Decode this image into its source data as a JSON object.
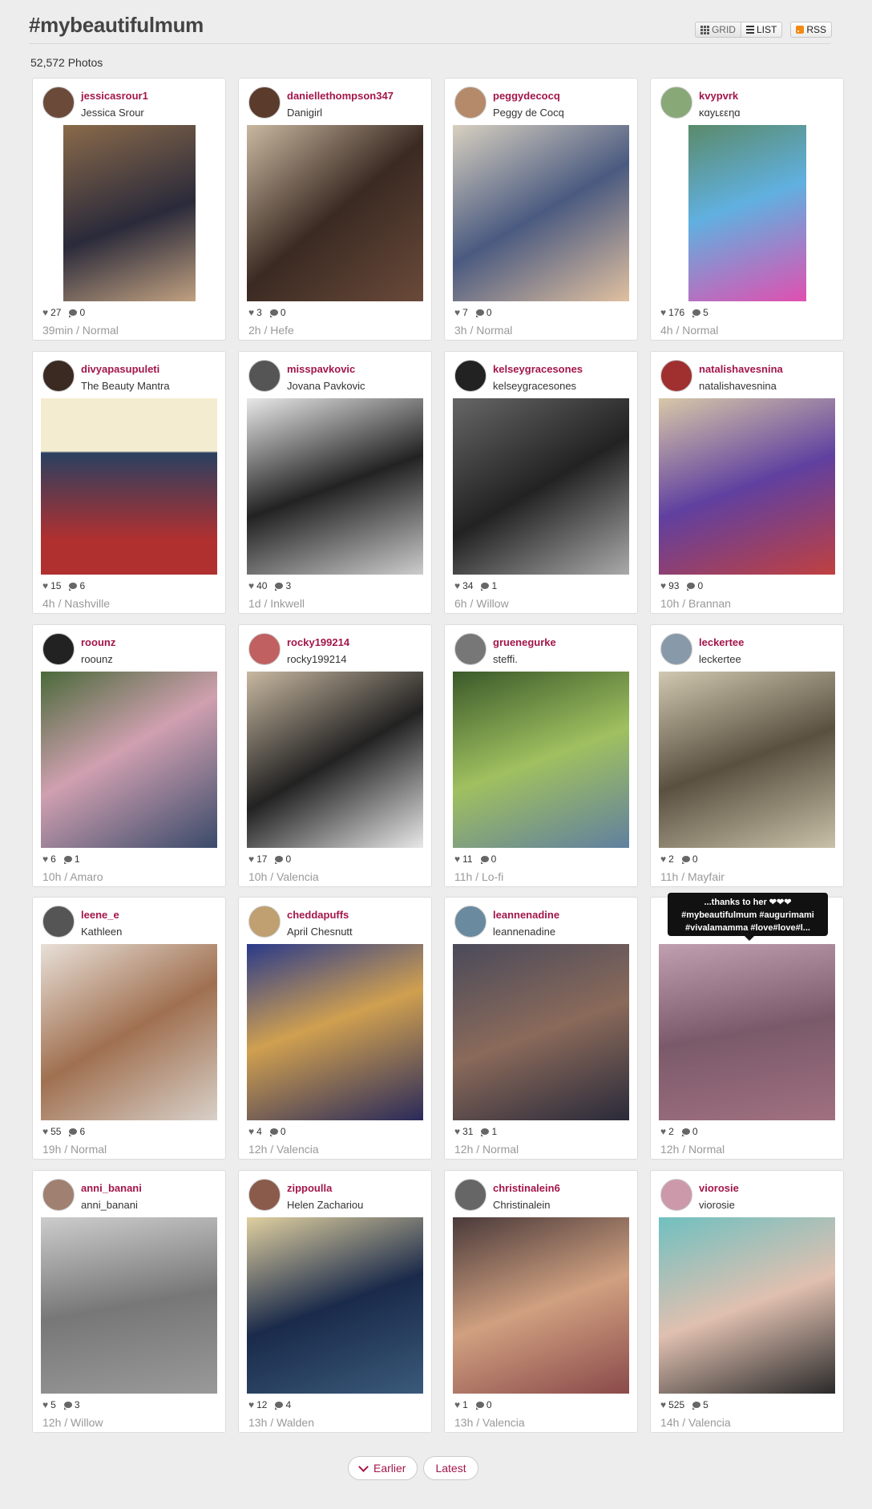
{
  "header": {
    "title": "#mybeautifulmum",
    "grid_label": "GRID",
    "list_label": "LIST",
    "rss_label": "RSS"
  },
  "photo_count": "52,572 Photos",
  "colors": {
    "username": "#a3164a",
    "meta": "#999999",
    "rss": "#f28a12"
  },
  "posts": [
    {
      "username": "jessicasrour1",
      "fullname": "Jessica Srour",
      "likes": "27",
      "comments": "0",
      "meta": "39min / Normal"
    },
    {
      "username": "daniellethompson347",
      "fullname": "Danigirl",
      "likes": "3",
      "comments": "0",
      "meta": "2h / Hefe"
    },
    {
      "username": "peggydecocq",
      "fullname": "Peggy de Cocq",
      "likes": "7",
      "comments": "0",
      "meta": "3h / Normal"
    },
    {
      "username": "kvypvrk",
      "fullname": "κɑуʟεεηɑ",
      "likes": "176",
      "comments": "5",
      "meta": "4h / Normal"
    },
    {
      "username": "divyapasupuleti",
      "fullname": "The Beauty Mantra",
      "likes": "15",
      "comments": "6",
      "meta": "4h / Nashville"
    },
    {
      "username": "misspavkovic",
      "fullname": "Jovana Pavkovic",
      "likes": "40",
      "comments": "3",
      "meta": "1d / Inkwell"
    },
    {
      "username": "kelseygracesones",
      "fullname": "kelseygracesones",
      "likes": "34",
      "comments": "1",
      "meta": "6h / Willow"
    },
    {
      "username": "natalishavesnina",
      "fullname": "natalishavesnina",
      "likes": "93",
      "comments": "0",
      "meta": "10h / Brannan"
    },
    {
      "username": "roounz",
      "fullname": "roounz",
      "likes": "6",
      "comments": "1",
      "meta": "10h / Amaro"
    },
    {
      "username": "rocky199214",
      "fullname": "rocky199214",
      "likes": "17",
      "comments": "0",
      "meta": "10h / Valencia"
    },
    {
      "username": "gruenegurke",
      "fullname": "steffi.",
      "likes": "11",
      "comments": "0",
      "meta": "11h / Lo-fi"
    },
    {
      "username": "leckertee",
      "fullname": "leckertee",
      "likes": "2",
      "comments": "0",
      "meta": "11h / Mayfair"
    },
    {
      "username": "leene_e",
      "fullname": "Kathleen",
      "likes": "55",
      "comments": "6",
      "meta": "19h / Normal"
    },
    {
      "username": "cheddapuffs",
      "fullname": "April Chesnutt",
      "likes": "4",
      "comments": "0",
      "meta": "12h / Valencia"
    },
    {
      "username": "leannenadine",
      "fullname": "leannenadine",
      "likes": "31",
      "comments": "1",
      "meta": "12h / Normal"
    },
    {
      "username": "",
      "fullname": "",
      "likes": "2",
      "comments": "0",
      "meta": "12h / Normal"
    },
    {
      "username": "anni_banani",
      "fullname": "anni_banani",
      "likes": "5",
      "comments": "3",
      "meta": "12h / Willow"
    },
    {
      "username": "zippoulla",
      "fullname": "Helen Zachariou",
      "likes": "12",
      "comments": "4",
      "meta": "13h / Walden"
    },
    {
      "username": "christinalein6",
      "fullname": "Christinalein",
      "likes": "1",
      "comments": "0",
      "meta": "13h / Valencia"
    },
    {
      "username": "viorosie",
      "fullname": "viorosie",
      "likes": "525",
      "comments": "5",
      "meta": "14h / Valencia"
    }
  ],
  "tooltip": {
    "line1": "...thanks to her ❤❤❤",
    "line2": "#mybeautifulmum #augurimami",
    "line3": "#vivalamamma #love#love#l..."
  },
  "pager": {
    "earlier": "Earlier",
    "latest": "Latest"
  }
}
